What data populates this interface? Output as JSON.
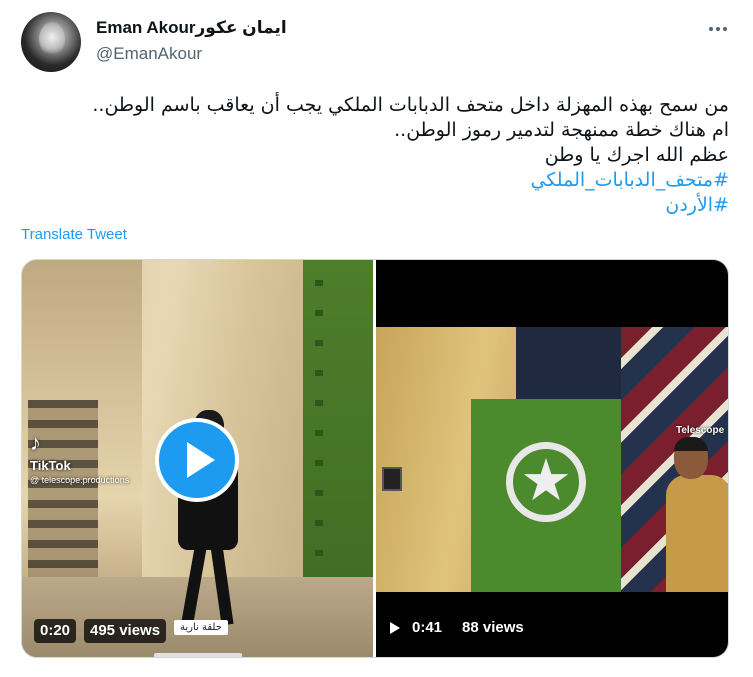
{
  "tweet": {
    "author": {
      "display_name": "Eman Akourايمان عكور",
      "handle": "@EmanAkour",
      "avatar_icon": "avatar-photo"
    },
    "more_icon": "more-horizontal-icon",
    "text_lines": [
      "من سمح بهذه المهزلة داخل متحف الدبابات الملكي يجب أن يعاقب باسم الوطن..",
      "ام هناك خطة ممنهجة لتدمير رموز الوطن..",
      "عظم الله اجرك يا وطن"
    ],
    "hashtags": [
      "#متحف_الدبابات_الملكي",
      "#الأردن"
    ],
    "translate_label": "Translate Tweet",
    "media": [
      {
        "kind": "video",
        "duration": "0:20",
        "views": "495 views",
        "watermark_brand": "TikTok",
        "watermark_user": "@ telescope.productions",
        "overlay_label": "حلقة نارية",
        "play_icon": "play-icon"
      },
      {
        "kind": "video",
        "duration": "0:41",
        "views": "88 views",
        "watermark_brand": "Telescope",
        "play_icon": "play-icon"
      }
    ]
  },
  "colors": {
    "text": "#0f1419",
    "secondary": "#536471",
    "accent": "#1d9bf0",
    "border": "#cfd9de"
  }
}
